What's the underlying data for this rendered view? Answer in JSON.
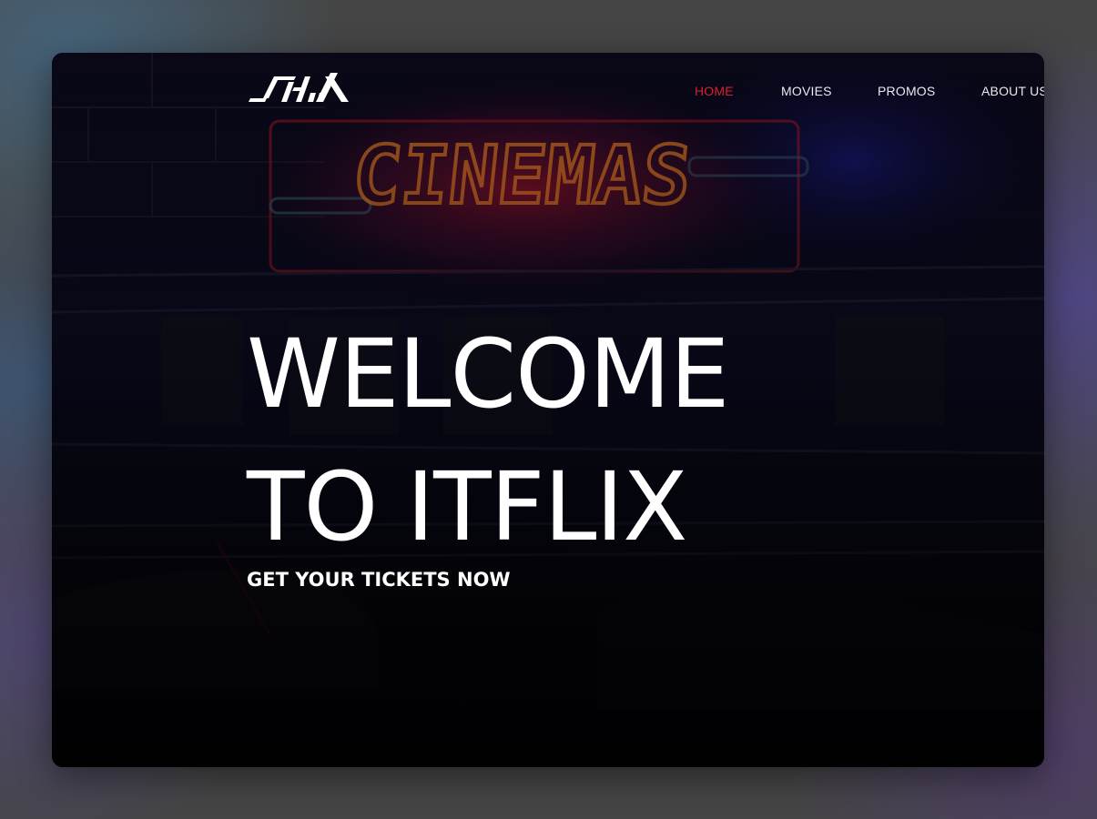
{
  "brand": {
    "logo_text": "ITFLIX",
    "sign_text": "CINEMAS"
  },
  "nav": {
    "items": [
      {
        "label": "HOME",
        "active": true
      },
      {
        "label": "MOVIES",
        "active": false
      },
      {
        "label": "PROMOS",
        "active": false
      },
      {
        "label": "ABOUT US",
        "active": false
      }
    ]
  },
  "hero": {
    "title_line1": "WELCOME",
    "title_line2": "TO ITFLIX",
    "subtitle": "GET YOUR TICKETS NOW"
  },
  "colors": {
    "accent_active": "#d8202a",
    "nav_text": "#e9e9ef",
    "hero_text": "#ffffff",
    "sign_neon": "#c46a1f",
    "sign_glow": "#b3122a"
  }
}
